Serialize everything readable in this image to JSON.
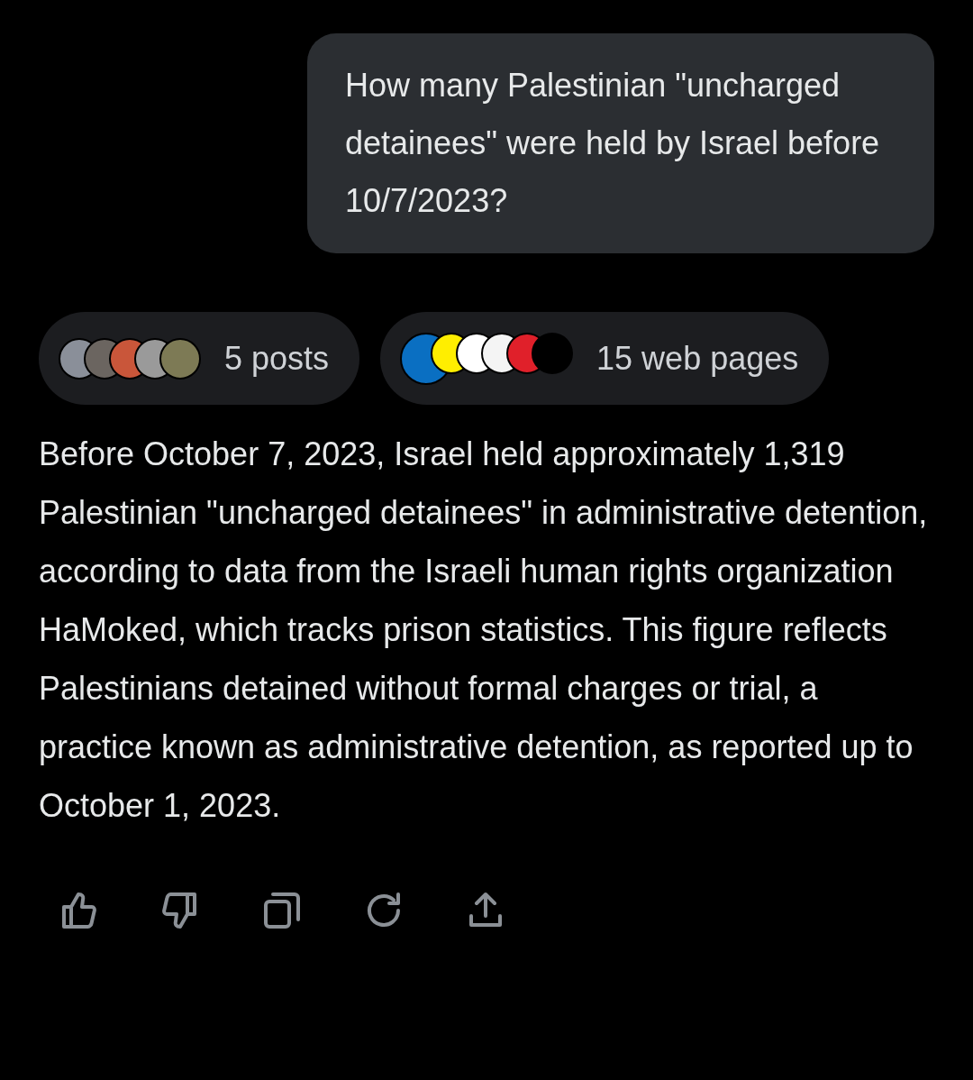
{
  "question": {
    "text": "How many Palestinian \"uncharged detainees\" were held by Israel before 10/7/2023?"
  },
  "sources": [
    {
      "kind": "posts",
      "label": "5 posts",
      "icons": [
        {
          "color": "#8a8f99"
        },
        {
          "color": "#6b6560"
        },
        {
          "color": "#c9563a"
        },
        {
          "color": "#9a9a9a"
        },
        {
          "color": "#7d7a55"
        }
      ]
    },
    {
      "kind": "web",
      "label": "15 web pages",
      "icons": [
        {
          "color": "#0a6fc2"
        },
        {
          "color": "#ffee00"
        },
        {
          "color": "#ffffff"
        },
        {
          "color": "#f4f4f4"
        },
        {
          "color": "#e0202a"
        },
        {
          "color": "#000000"
        }
      ]
    }
  ],
  "answer": {
    "text": "Before October 7, 2023, Israel held approximately 1,319 Palestinian \"uncharged detainees\" in administrative detention, according to data from the Israeli human rights organization HaMoked, which tracks prison statistics. This figure reflects Palestinians detained without formal charges or trial, a practice known as administrative detention, as reported up to October 1, 2023."
  },
  "actions": [
    {
      "kind": "like"
    },
    {
      "kind": "dislike"
    },
    {
      "kind": "copy"
    },
    {
      "kind": "regenerate"
    },
    {
      "kind": "share"
    }
  ]
}
